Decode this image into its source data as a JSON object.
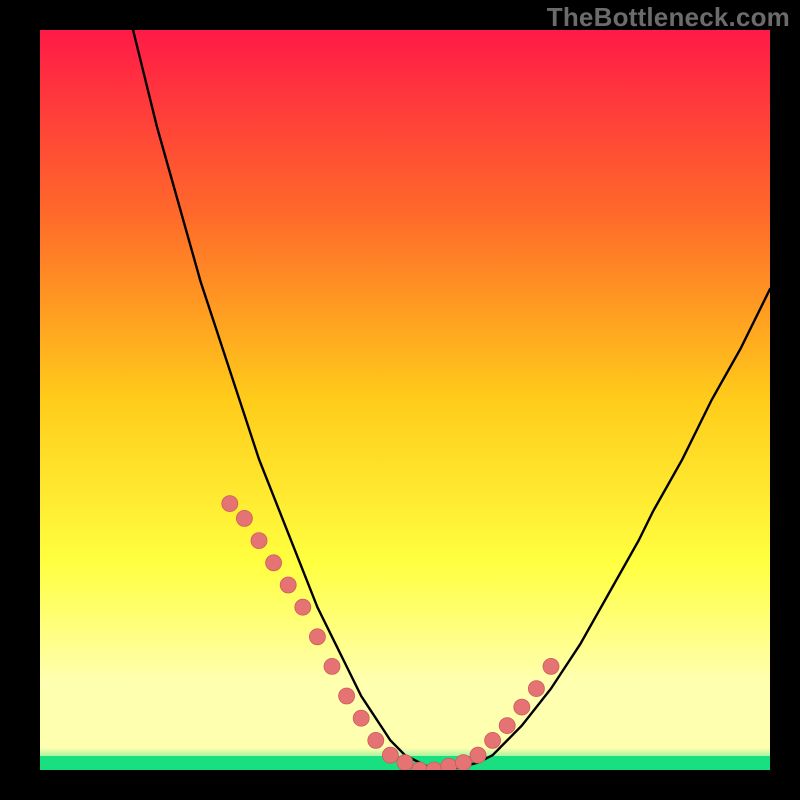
{
  "watermark": "TheBottleneck.com",
  "colors": {
    "background": "#000000",
    "gradient_top": "#ff1a47",
    "gradient_mid1": "#ff6a2a",
    "gradient_mid2": "#ffcc1a",
    "gradient_mid3": "#ffff40",
    "gradient_mid4": "#ffffb0",
    "gradient_bottom": "#18e080",
    "curve": "#000000",
    "marker_fill": "#e57373",
    "marker_stroke": "#cf5b5b"
  },
  "chart_data": {
    "type": "line",
    "title": "",
    "xlabel": "",
    "ylabel": "",
    "xlim": [
      0,
      100
    ],
    "ylim": [
      0,
      100
    ],
    "x": [
      0,
      2,
      4,
      6,
      8,
      10,
      12,
      14,
      16,
      18,
      20,
      22,
      24,
      26,
      28,
      30,
      32,
      34,
      36,
      38,
      40,
      42,
      44,
      46,
      48,
      50,
      52,
      54,
      56,
      58,
      60,
      62,
      64,
      66,
      68,
      70,
      72,
      74,
      76,
      78,
      80,
      82,
      84,
      86,
      88,
      90,
      92,
      94,
      96,
      98,
      100
    ],
    "values": [
      155,
      146,
      137,
      128,
      119,
      111,
      103,
      95,
      87,
      80,
      73,
      66,
      60,
      54,
      48,
      42,
      37,
      32,
      27,
      22,
      18,
      14,
      10,
      7,
      4,
      2,
      1,
      0,
      0,
      0.5,
      1,
      2,
      4,
      6,
      8.5,
      11,
      14,
      17,
      20.5,
      24,
      27.5,
      31,
      35,
      38.5,
      42,
      46,
      50,
      53.5,
      57,
      61,
      65
    ],
    "marker_x": [
      26,
      28,
      30,
      32,
      34,
      36,
      38,
      40,
      42,
      44,
      46,
      48,
      50,
      52,
      54,
      56,
      58,
      60,
      62,
      64,
      66,
      68,
      70
    ],
    "marker_y": [
      36,
      34,
      31,
      28,
      25,
      22,
      18,
      14,
      10,
      7,
      4,
      2,
      1,
      0,
      0,
      0.5,
      1,
      2,
      4,
      6,
      8.5,
      11,
      14
    ]
  }
}
